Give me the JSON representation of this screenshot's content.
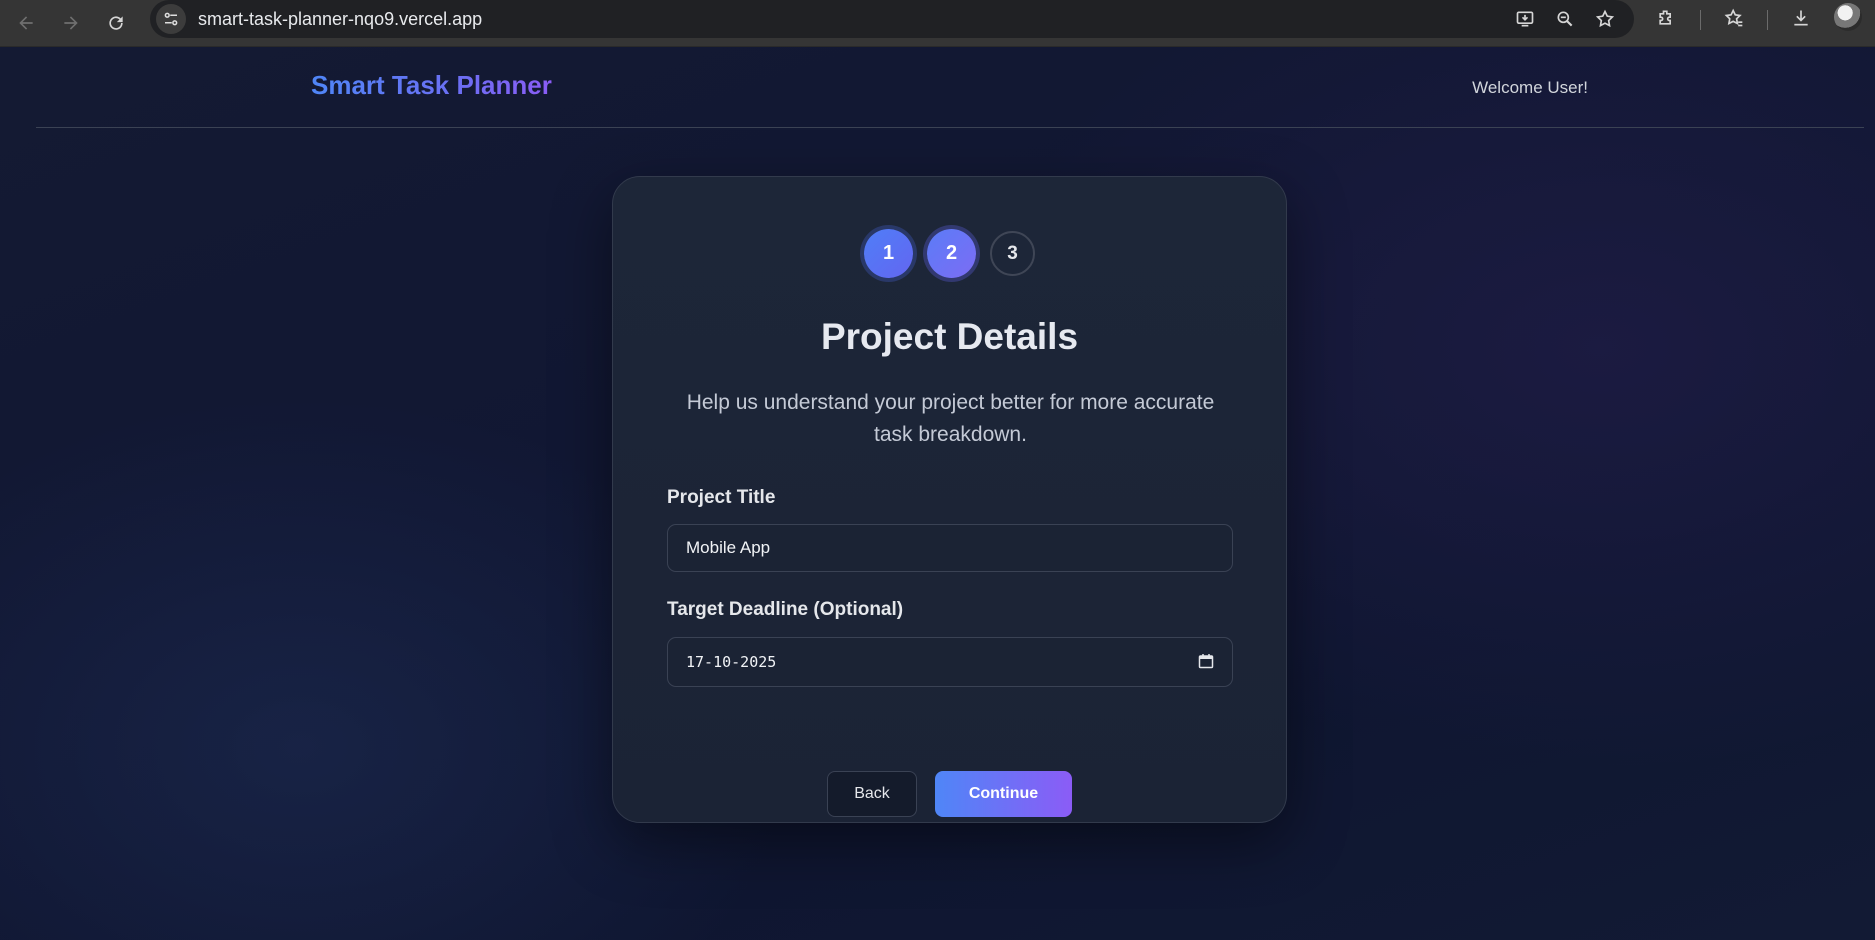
{
  "browser": {
    "url": "smart-task-planner-nqo9.vercel.app",
    "icons": [
      "back-arrow-icon",
      "forward-arrow-icon",
      "reload-icon",
      "site-info-icon",
      "install-icon",
      "zoom-icon",
      "bookmark-star-icon",
      "extensions-icon",
      "bookmarks-icon",
      "download-icon",
      "profile-avatar"
    ]
  },
  "header": {
    "brand": "Smart Task Planner",
    "welcome": "Welcome User!"
  },
  "stepper": {
    "steps": [
      {
        "label": "1",
        "state": "completed"
      },
      {
        "label": "2",
        "state": "current"
      },
      {
        "label": "3",
        "state": "pending"
      }
    ]
  },
  "form": {
    "title": "Project Details",
    "subtitle": "Help us understand your project better for more accurate task breakdown.",
    "project_title_label": "Project Title",
    "project_title_value": "Mobile App",
    "deadline_label": "Target Deadline (Optional)",
    "deadline_value": "17-10-2025",
    "back_label": "Back",
    "continue_label": "Continue"
  },
  "colors": {
    "accent_start": "#4f86f7",
    "accent_end": "#8b5cf6",
    "card_bg": "#1d2638",
    "page_bg": "#111733"
  }
}
